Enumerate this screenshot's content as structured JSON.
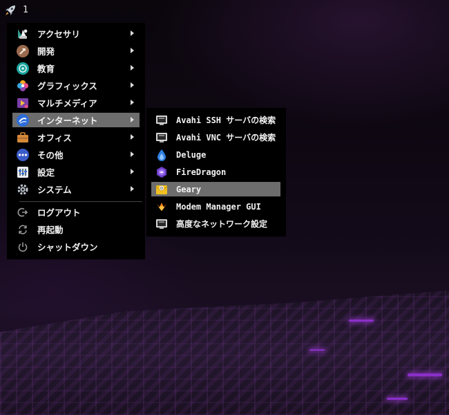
{
  "top_panel": {
    "workspace_number": "1",
    "launcher_icon": "rocket-icon"
  },
  "main_menu": {
    "items": [
      {
        "label": "アクセサリ",
        "icon": "accessories-icon",
        "has_submenu": true
      },
      {
        "label": "開発",
        "icon": "development-icon",
        "has_submenu": true
      },
      {
        "label": "教育",
        "icon": "education-icon",
        "has_submenu": true
      },
      {
        "label": "グラフィックス",
        "icon": "graphics-icon",
        "has_submenu": true
      },
      {
        "label": "マルチメディア",
        "icon": "multimedia-icon",
        "has_submenu": true
      },
      {
        "label": "インターネット",
        "icon": "internet-icon",
        "has_submenu": true,
        "active": true
      },
      {
        "label": "オフィス",
        "icon": "office-icon",
        "has_submenu": true
      },
      {
        "label": "その他",
        "icon": "other-icon",
        "has_submenu": true
      },
      {
        "label": "設定",
        "icon": "settings-icon",
        "has_submenu": true
      },
      {
        "label": "システム",
        "icon": "system-icon",
        "has_submenu": true
      }
    ],
    "session_items": [
      {
        "label": "ログアウト",
        "icon": "logout-icon"
      },
      {
        "label": "再起動",
        "icon": "restart-icon"
      },
      {
        "label": "シャットダウン",
        "icon": "shutdown-icon"
      }
    ]
  },
  "internet_submenu": {
    "items": [
      {
        "label": "Avahi SSH サーバの検索",
        "icon": "network-server-icon"
      },
      {
        "label": "Avahi VNC サーバの検索",
        "icon": "network-server-icon"
      },
      {
        "label": "Deluge",
        "icon": "deluge-icon"
      },
      {
        "label": "FireDragon",
        "icon": "firedragon-icon"
      },
      {
        "label": "Geary",
        "icon": "geary-mail-icon",
        "active": true
      },
      {
        "label": "Modem Manager GUI",
        "icon": "modem-manager-icon"
      },
      {
        "label": "高度なネットワーク設定",
        "icon": "network-server-icon"
      }
    ]
  },
  "colors": {
    "menu_bg": "#000000",
    "highlight": "#6d6d6d",
    "accent_purple": "#8b2fc9"
  }
}
